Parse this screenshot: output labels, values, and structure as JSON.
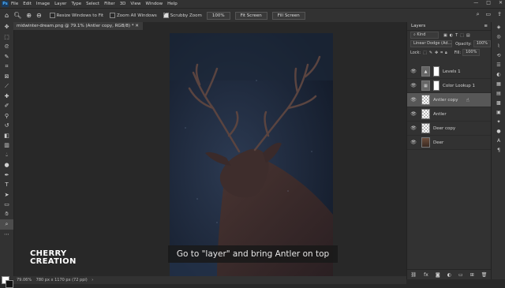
{
  "app": {
    "logo": "Ps"
  },
  "menu": [
    "File",
    "Edit",
    "Image",
    "Layer",
    "Type",
    "Select",
    "Filter",
    "3D",
    "View",
    "Window",
    "Help"
  ],
  "options": {
    "resize_windows": "Resize Windows to Fit",
    "zoom_all": "Zoom All Windows",
    "scrubby_zoom": "Scrubby Zoom",
    "zoom_value": "100%",
    "fit_screen": "Fit Screen",
    "fill_screen": "Fill Screen"
  },
  "document": {
    "tab_title": "midwinter-dream.png @ 79.1% (Antler copy, RGB/8) *",
    "status_zoom": "79.06%",
    "status_dims": "780 px x 1170 px (72 ppi)"
  },
  "caption": "Go to \"layer\" and bring Antler on top",
  "brand": {
    "line1": "CHERRY",
    "line2": "CREATION"
  },
  "layers_panel": {
    "title": "Layers",
    "kind": "Kind",
    "blend_mode": "Linear Dodge (Ad...",
    "opacity_label": "Opacity:",
    "opacity_value": "100%",
    "lock_label": "Lock:",
    "fill_label": "Fill:",
    "fill_value": "100%",
    "layers": [
      {
        "name": "Levels 1",
        "type": "adjustment",
        "selected": false
      },
      {
        "name": "Color Lookup 1",
        "type": "adjustment",
        "selected": false
      },
      {
        "name": "Antler copy",
        "type": "pixel",
        "selected": true
      },
      {
        "name": "Antler",
        "type": "pixel",
        "selected": false
      },
      {
        "name": "Deer copy",
        "type": "pixel",
        "selected": false
      },
      {
        "name": "Deer",
        "type": "photo",
        "selected": false
      }
    ]
  },
  "colors": {
    "accent": "#31a8ff",
    "panel_bg": "#323232",
    "workspace_bg": "#282828",
    "selected_layer": "#575757"
  }
}
